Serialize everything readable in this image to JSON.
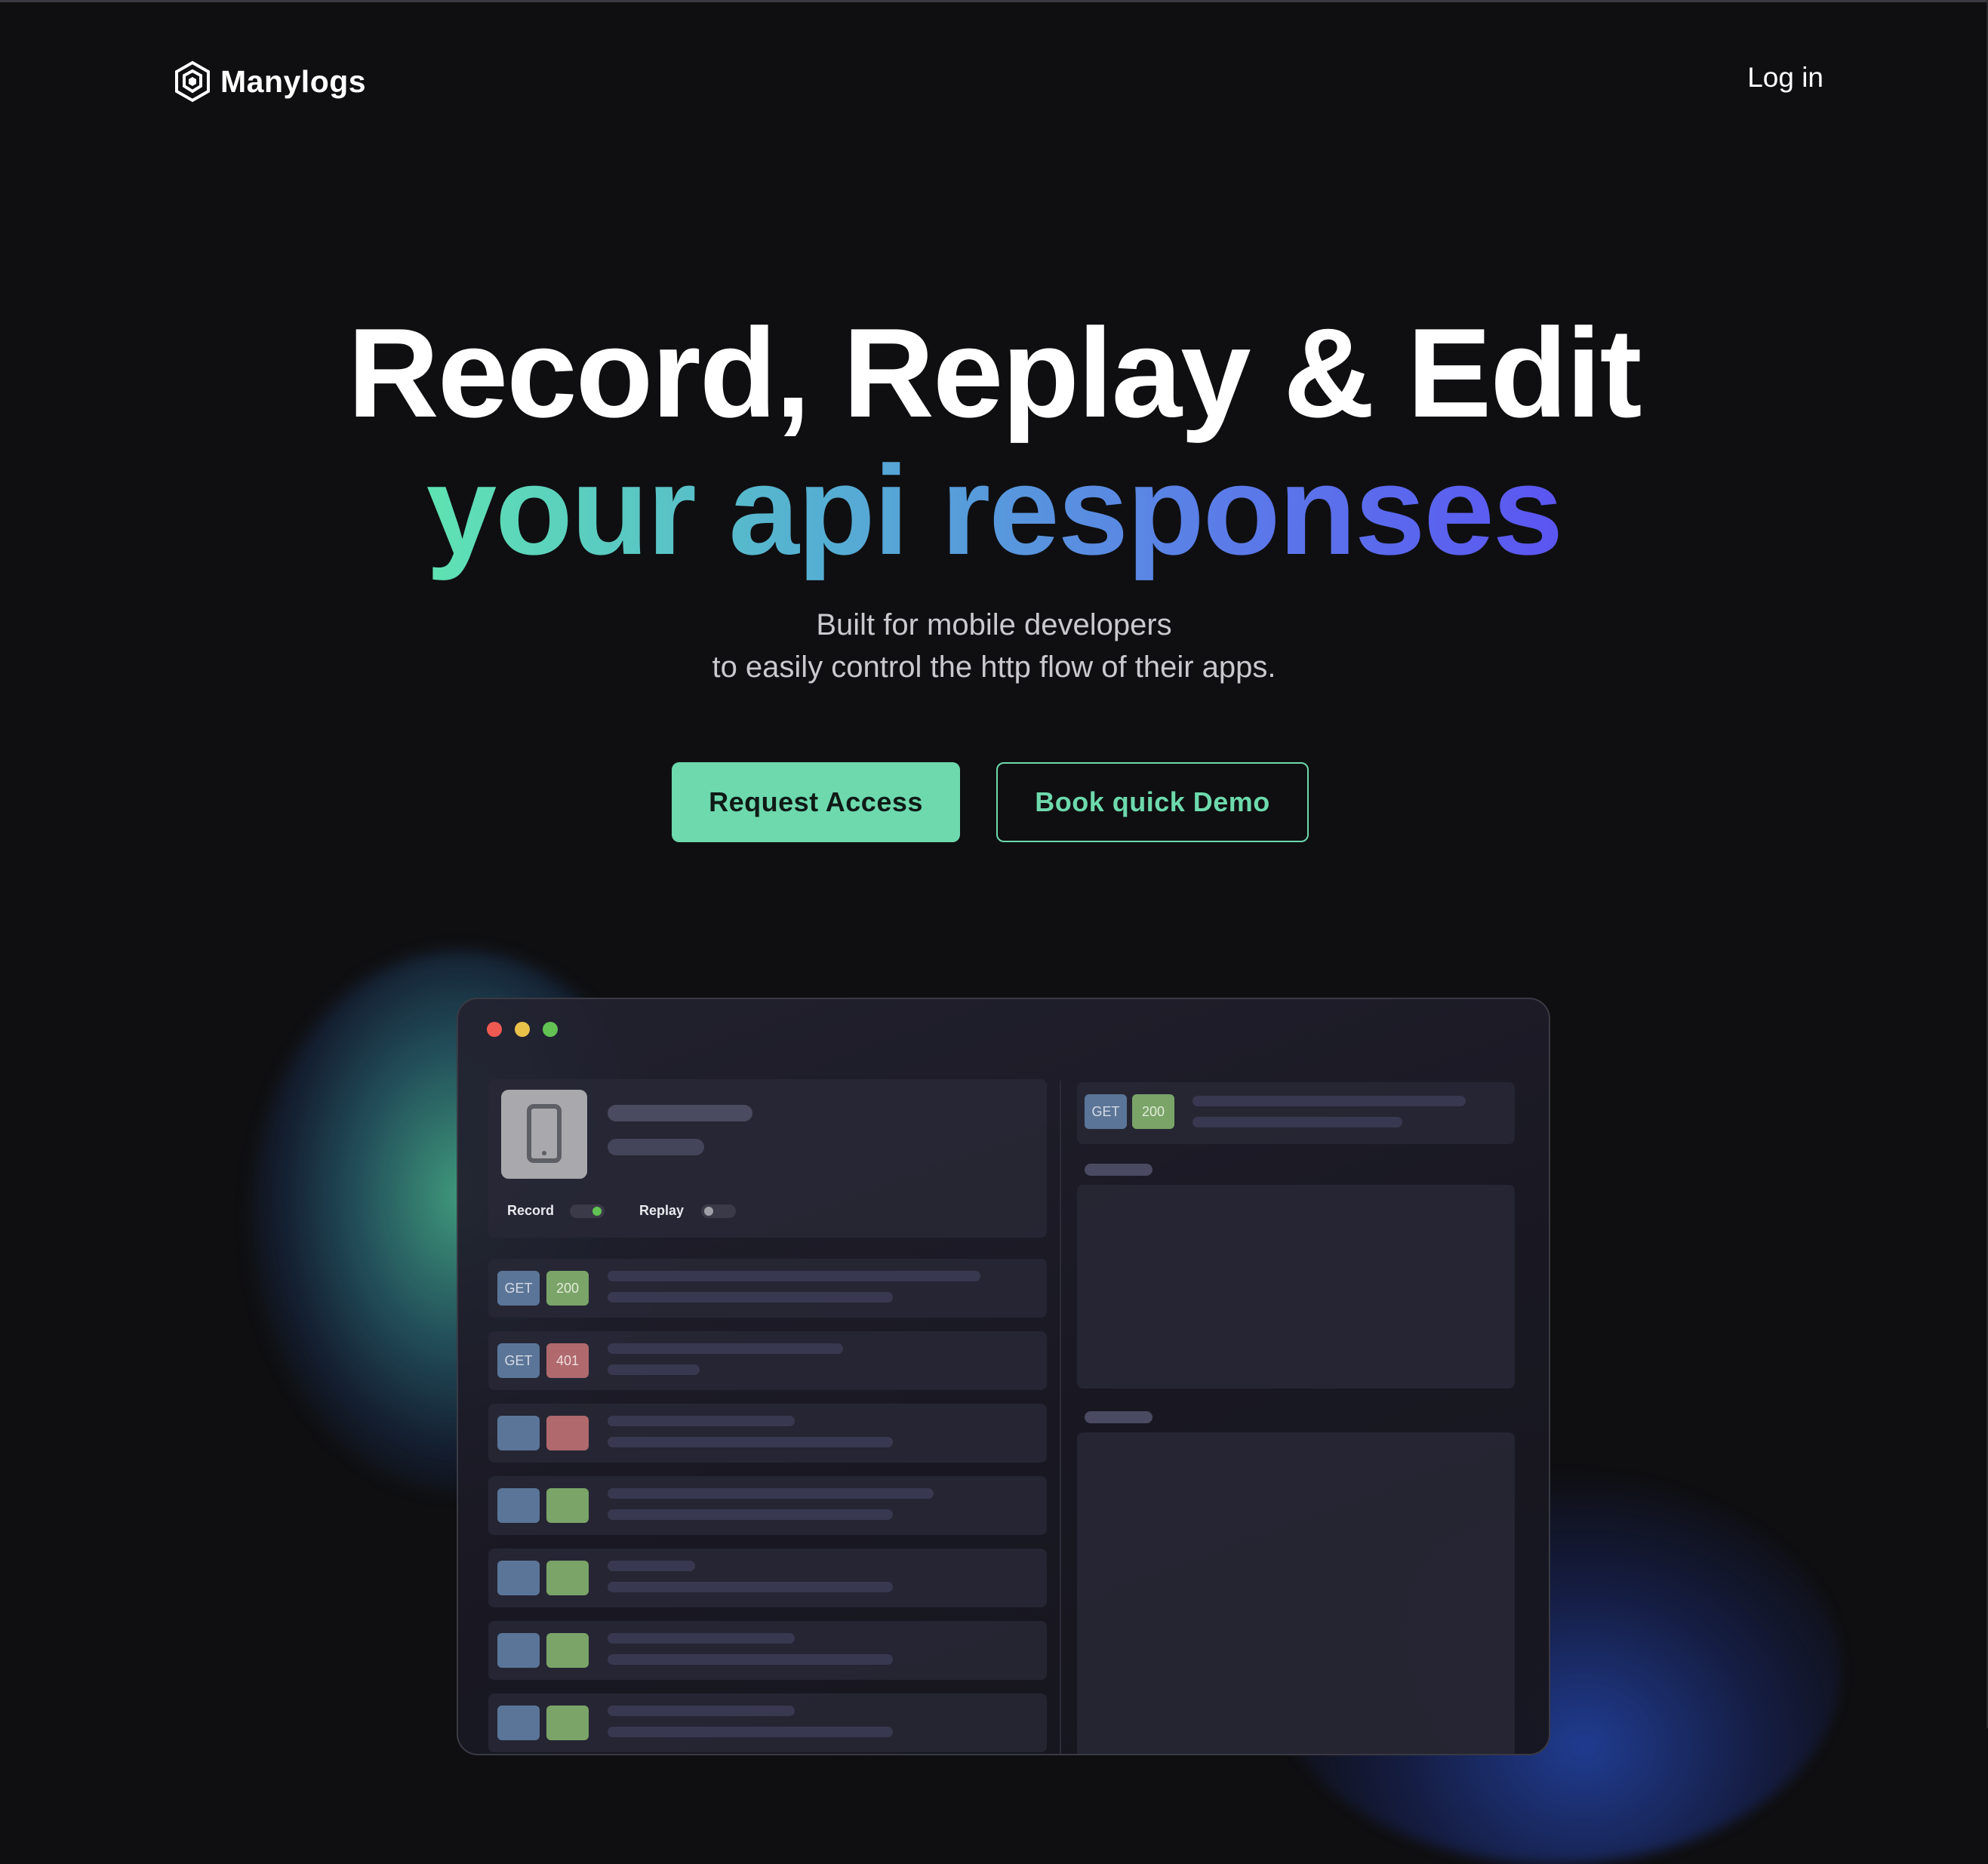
{
  "nav": {
    "brand": "Manylogs",
    "login": "Log in"
  },
  "hero": {
    "line1": "Record, Replay & Edit",
    "line2": "your api responses",
    "sub_line1": "Built for mobile developers",
    "sub_line2": "to easily control the http flow of their apps.",
    "primary_cta": "Request Access",
    "secondary_cta": "Book quick Demo"
  },
  "app": {
    "record_label": "Record",
    "replay_label": "Replay",
    "requests": [
      {
        "method": "GET",
        "status": "200",
        "status_kind": "ok"
      },
      {
        "method": "GET",
        "status": "401",
        "status_kind": "err"
      },
      {
        "method": "",
        "status": "",
        "status_kind": "err"
      },
      {
        "method": "",
        "status": "",
        "status_kind": "ok"
      },
      {
        "method": "",
        "status": "",
        "status_kind": "ok"
      },
      {
        "method": "",
        "status": "",
        "status_kind": "ok"
      },
      {
        "method": "",
        "status": "",
        "status_kind": "ok"
      }
    ],
    "detail": {
      "method": "GET",
      "status": "200"
    }
  },
  "colors": {
    "accent": "#6dd9ad",
    "background": "#0f0f11",
    "get_chip": "#5a7597",
    "ok_chip": "#7aa468",
    "err_chip": "#b06a6e"
  },
  "icons": [
    "logo-hexagon-icon",
    "mobile-device-icon"
  ]
}
